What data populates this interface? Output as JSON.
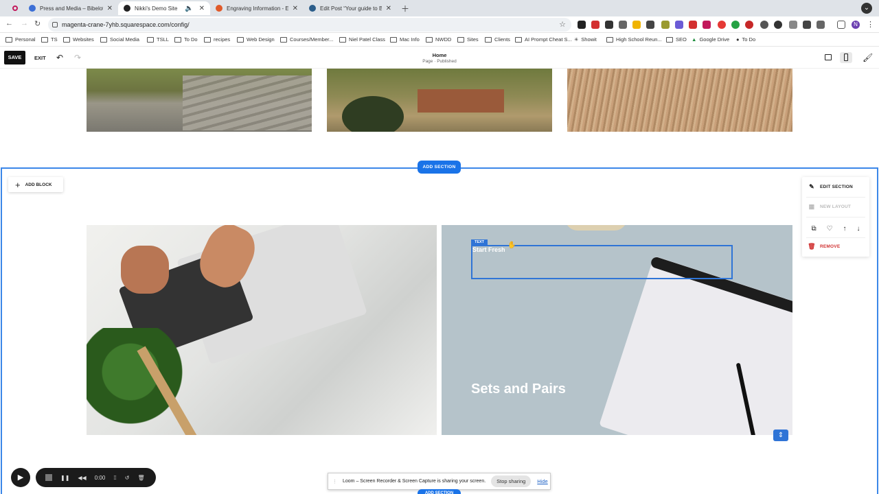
{
  "browser": {
    "tabs": [
      {
        "title": "Press and Media – Bibelot Ha",
        "fav_color": "#3c6fd6"
      },
      {
        "title": "Nikki's Demo Site",
        "fav_color": "#222222"
      },
      {
        "title": "Engraving Information - Entri",
        "fav_color": "#e05a2a"
      },
      {
        "title": "Edit Post “Your guide to Bra",
        "fav_color": "#2b5d8a"
      }
    ],
    "url": "magenta-crane-7yhb.squarespace.com/config/",
    "bookmarks": [
      "Personal",
      "TS",
      "Social Media",
      "TSLL",
      "To Do",
      "recipes",
      "Websites",
      "Web Design",
      "Courses/Member...",
      "Niel Patel Class",
      "Mac Info",
      "NWDD",
      "Sites",
      "Clients",
      "AI Prompt Cheat S...",
      "Showit",
      "High School Reun...",
      "SEO",
      "Google Drive",
      "To Do"
    ],
    "profile_initial": "N"
  },
  "editor": {
    "save_label": "SAVE",
    "exit_label": "EXIT",
    "page_title": "Home",
    "page_status": "Page · Published"
  },
  "content": {
    "add_section_label": "ADD SECTION",
    "add_block_label": "ADD BLOCK",
    "text_tag": "TEXT",
    "start_fresh": "Start Fresh",
    "sets_pairs": "Sets and Pairs"
  },
  "section_menu": {
    "edit": "EDIT SECTION",
    "new_layout": "NEW LAYOUT",
    "remove": "REMOVE"
  },
  "loom": {
    "timer": "0:00",
    "message": "Loom – Screen Recorder & Screen Capture is sharing your screen.",
    "stop_label": "Stop sharing",
    "hide_label": "Hide"
  }
}
